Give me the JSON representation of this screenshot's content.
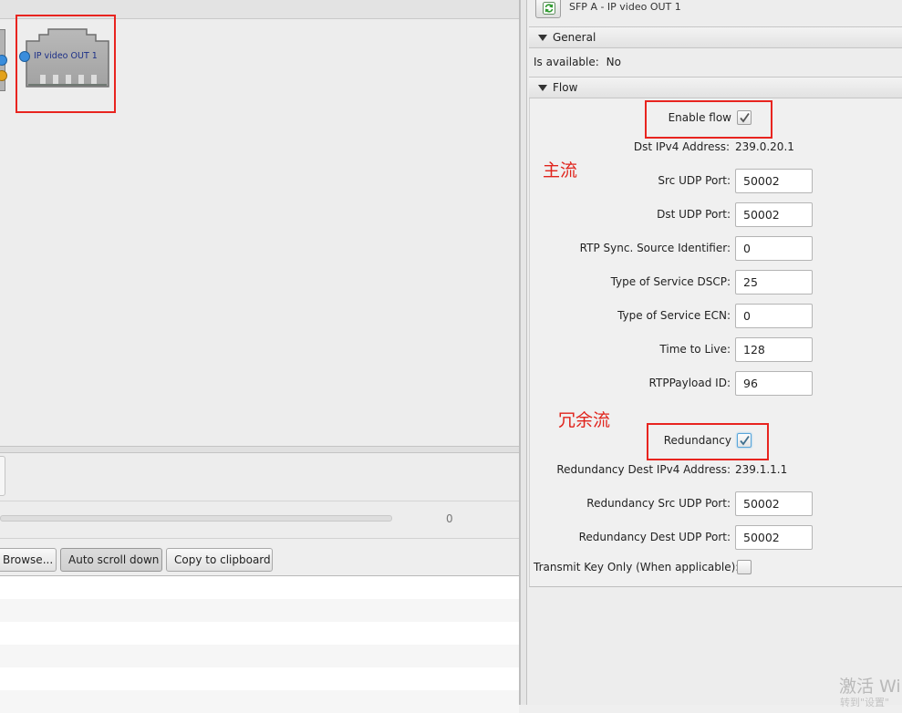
{
  "canvas": {
    "node_label": "IP video OUT 1"
  },
  "log_panel": {
    "progress_value": "0",
    "buttons": {
      "browse": "Browse...",
      "auto_scroll": "Auto scroll down",
      "copy": "Copy to clipboard"
    }
  },
  "right_panel": {
    "header_title": "SFP A -  IP video OUT 1",
    "general": {
      "title": "General",
      "is_available_label": "Is available:",
      "is_available_value": "No"
    },
    "flow": {
      "title": "Flow",
      "enable_flow_label": "Enable flow",
      "enable_flow_checked": true,
      "dst_ipv4_label": "Dst IPv4 Address:",
      "dst_ipv4_value": "239.0.20.1",
      "src_udp_label": "Src UDP Port:",
      "src_udp_value": "50002",
      "dst_udp_label": "Dst UDP Port:",
      "dst_udp_value": "50002",
      "rtp_ssrc_label": "RTP Sync. Source Identifier:",
      "rtp_ssrc_value": "0",
      "tos_dscp_label": "Type of Service DSCP:",
      "tos_dscp_value": "25",
      "tos_ecn_label": "Type of Service ECN:",
      "tos_ecn_value": "0",
      "ttl_label": "Time to Live:",
      "ttl_value": "128",
      "rtp_payload_label": "RTPPayload ID:",
      "rtp_payload_value": "96",
      "redundancy_label": "Redundancy",
      "redundancy_checked": true,
      "red_dst_ipv4_label": "Redundancy Dest IPv4 Address:",
      "red_dst_ipv4_value": "239.1.1.1",
      "red_src_udp_label": "Redundancy Src UDP Port:",
      "red_src_udp_value": "50002",
      "red_dst_udp_label": "Redundancy Dest UDP Port:",
      "red_dst_udp_value": "50002",
      "transmit_key_label": "Transmit Key Only (When applicable):",
      "transmit_key_checked": false
    }
  },
  "annotations": {
    "main_stream": "主流",
    "redundant_stream": "冗余流"
  },
  "watermark": {
    "text": "激活 Wi",
    "subtext": "转到\"设置\""
  },
  "colors": {
    "highlight": "#e8241f",
    "annotation": "#e0241c",
    "node_label": "#1c2f87",
    "port_blue": "#3a8ddc",
    "port_orange": "#e3a21a"
  }
}
